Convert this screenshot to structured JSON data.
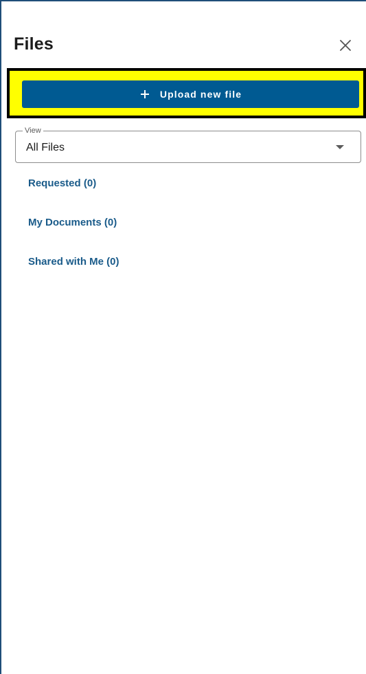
{
  "panel": {
    "title": "Files",
    "close_icon": "close-icon"
  },
  "upload": {
    "icon": "plus-icon",
    "label": "Upload new file"
  },
  "view_select": {
    "legend": "View",
    "value": "All Files",
    "caret_icon": "caret-down-icon"
  },
  "nav": {
    "items": [
      {
        "label": "Requested (0)"
      },
      {
        "label": "My Documents (0)"
      },
      {
        "label": "Shared with Me (0)"
      }
    ]
  },
  "colors": {
    "primary_button": "#005a92",
    "link": "#1a5b8a",
    "highlight": "#ffff00",
    "panel_border": "#1f4e79"
  }
}
